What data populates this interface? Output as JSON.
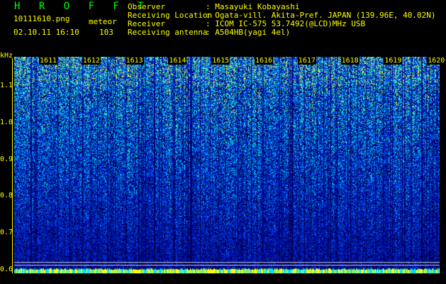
{
  "header": {
    "brand": "H R O F F T",
    "filename": "10111610.png",
    "mode": "meteor",
    "datetime": "02.10.11 16:10",
    "count": "103"
  },
  "meta": {
    "labels": [
      "Observer",
      "Receiving Location",
      "Receiver",
      "Receiving antenna"
    ],
    "values": [
      ": Masayuki Kobayashi",
      ": Ogata-vill. Akita-Pref. JAPAN (139.96E, 40.02N)",
      ": ICOM IC-575 53.7492(@LCD)MHz USB",
      ": A504HB(yagi 4el)"
    ]
  },
  "chart_data": {
    "type": "heatmap",
    "title": "",
    "ylabel": "kHz",
    "xlabel": "",
    "x_ticks": [
      "1611",
      "1612",
      "1613",
      "1614",
      "1615",
      "1616",
      "1617",
      "1618",
      "1619",
      "1620"
    ],
    "y_ticks": [
      "1.1",
      "1.0",
      "0.9",
      "0.8",
      "0.7",
      "0.6"
    ],
    "ylim": [
      0.59,
      1.18
    ],
    "colors": {
      "low": "#000060",
      "mid": "#0030ff",
      "high": "#00ffd0",
      "peak": "#ffff00"
    }
  }
}
